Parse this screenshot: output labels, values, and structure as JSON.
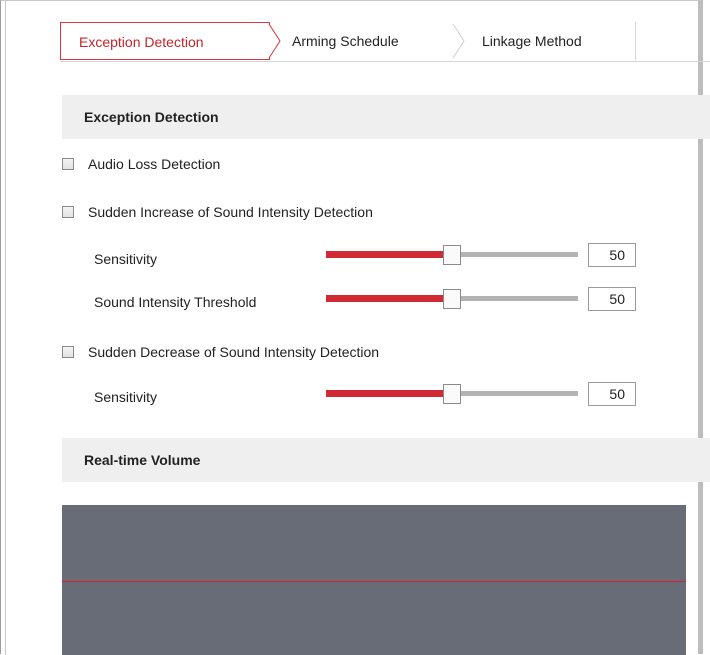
{
  "tabs": [
    {
      "label": "Exception Detection",
      "active": true
    },
    {
      "label": "Arming Schedule",
      "active": false
    },
    {
      "label": "Linkage Method",
      "active": false
    }
  ],
  "exception_section": {
    "title": "Exception Detection",
    "audio_loss": {
      "label": "Audio Loss Detection",
      "checked": false
    },
    "sudden_increase": {
      "label": "Sudden Increase of Sound Intensity Detection",
      "checked": false,
      "sensitivity": {
        "label": "Sensitivity",
        "value": "50",
        "fraction": 0.5
      },
      "threshold": {
        "label": "Sound Intensity Threshold",
        "value": "50",
        "fraction": 0.5
      }
    },
    "sudden_decrease": {
      "label": "Sudden Decrease of Sound Intensity Detection",
      "checked": false,
      "sensitivity": {
        "label": "Sensitivity",
        "value": "50",
        "fraction": 0.5
      }
    }
  },
  "volume_section": {
    "title": "Real-time Volume"
  },
  "colors": {
    "accent": "#d12a34",
    "track": "#b3b3b3",
    "volume_bg": "#686c77"
  }
}
